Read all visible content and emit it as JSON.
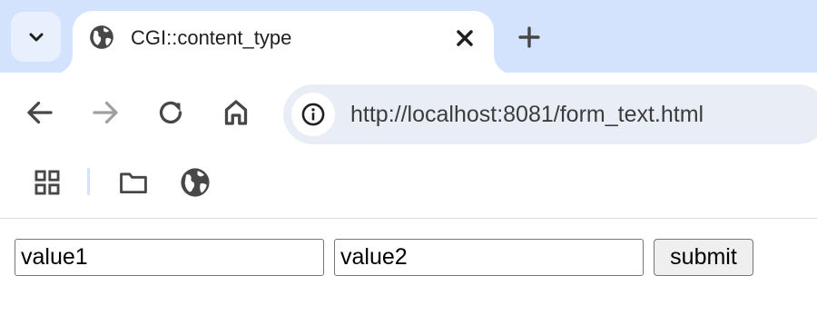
{
  "tab": {
    "title": "CGI::content_type"
  },
  "toolbar": {
    "url": "http://localhost:8081/form_text.html"
  },
  "form": {
    "field1_value": "value1",
    "field2_value": "value2",
    "submit_label": "submit"
  },
  "icons": {
    "tab_search": "chevron-down-icon",
    "favicon": "globe-icon",
    "close": "close-icon",
    "new_tab": "plus-icon",
    "back": "arrow-left-icon",
    "forward": "arrow-right-icon",
    "reload": "reload-icon",
    "home": "home-icon",
    "site_info": "info-icon",
    "apps": "grid-icon",
    "folder": "folder-icon",
    "bookmark_globe": "globe-icon"
  },
  "colors": {
    "tabstrip_bg": "#d3e3fd",
    "omnibox_bg": "#e9eef6",
    "icon": "#474747",
    "forward_disabled": "#a0a0a0"
  }
}
